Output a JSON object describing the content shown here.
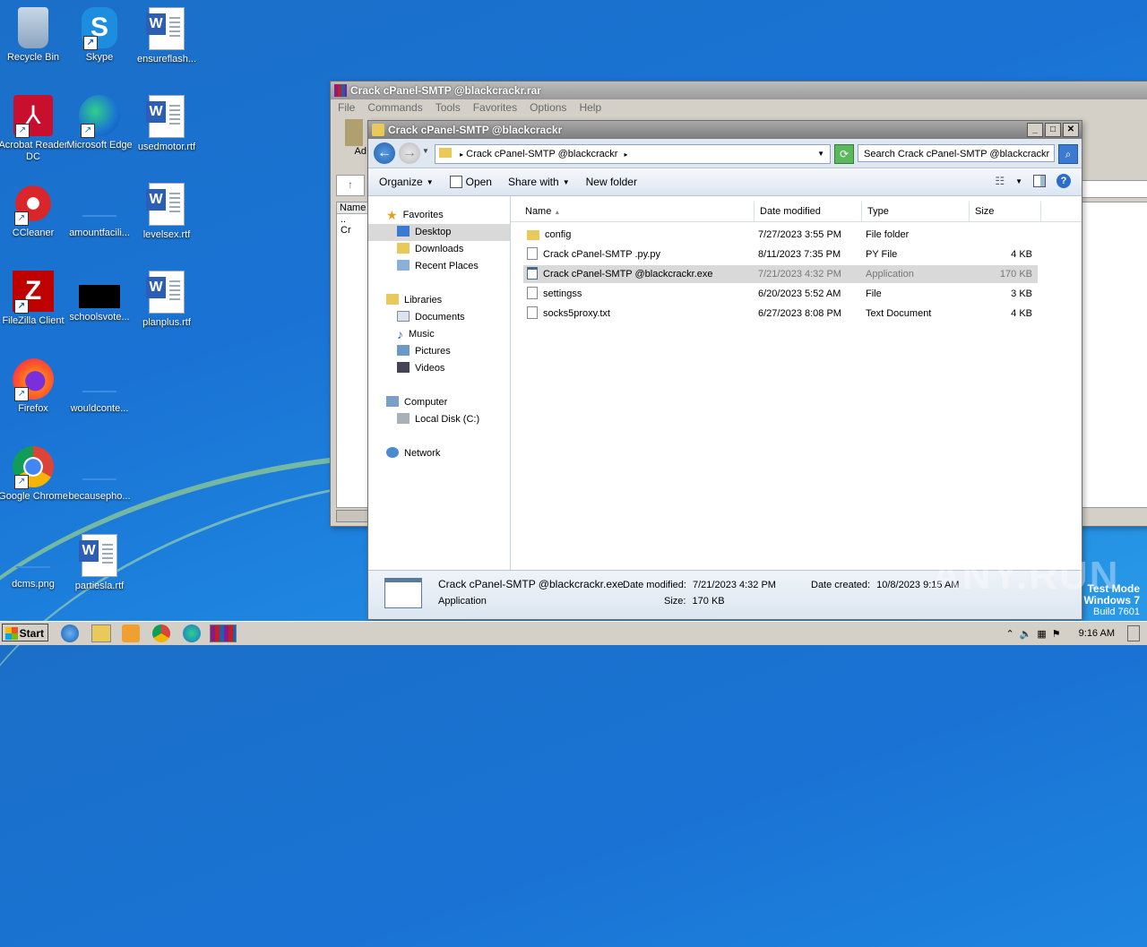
{
  "desktop": {
    "icons": [
      {
        "label": "Recycle Bin"
      },
      {
        "label": "Skype"
      },
      {
        "label": "ensureflash..."
      },
      {
        "label": "Acrobat Reader DC"
      },
      {
        "label": "Microsoft Edge"
      },
      {
        "label": "usedmotor.rtf"
      },
      {
        "label": "CCleaner"
      },
      {
        "label": "amountfacili..."
      },
      {
        "label": "levelsex.rtf"
      },
      {
        "label": "FileZilla Client"
      },
      {
        "label": "schoolsvote..."
      },
      {
        "label": "planplus.rtf"
      },
      {
        "label": "Firefox"
      },
      {
        "label": "wouldconte..."
      },
      {
        "label": "Google Chrome"
      },
      {
        "label": "becausepho..."
      },
      {
        "label": "dcms.png"
      },
      {
        "label": "partiesla.rtf"
      }
    ]
  },
  "rar_window": {
    "title": "Crack cPanel-SMTP @blackcrackr.rar",
    "menu": [
      "File",
      "Commands",
      "Tools",
      "Favorites",
      "Options",
      "Help"
    ],
    "add_label": "Ad",
    "col_name": "Name",
    "row1": "..",
    "row2": "Cr"
  },
  "explorer": {
    "title": "Crack cPanel-SMTP @blackcrackr",
    "address": "Crack cPanel-SMTP @blackcrackr",
    "search_placeholder": "Search Crack cPanel-SMTP @blackcrackr",
    "toolbar": {
      "organize": "Organize",
      "open": "Open",
      "share_with": "Share with",
      "new_folder": "New folder"
    },
    "nav": {
      "favorites": "Favorites",
      "desktop": "Desktop",
      "downloads": "Downloads",
      "recent_places": "Recent Places",
      "libraries": "Libraries",
      "documents": "Documents",
      "music": "Music",
      "pictures": "Pictures",
      "videos": "Videos",
      "computer": "Computer",
      "local_disk": "Local Disk (C:)",
      "network": "Network"
    },
    "columns": {
      "name": "Name",
      "date": "Date modified",
      "type": "Type",
      "size": "Size"
    },
    "files": [
      {
        "name": "config",
        "date": "7/27/2023 3:55 PM",
        "type": "File folder",
        "size": ""
      },
      {
        "name": "Crack cPanel-SMTP .py.py",
        "date": "8/11/2023 7:35 PM",
        "type": "PY File",
        "size": "4 KB"
      },
      {
        "name": "Crack cPanel-SMTP @blackcrackr.exe",
        "date": "7/21/2023 4:32 PM",
        "type": "Application",
        "size": "170 KB"
      },
      {
        "name": "settingss",
        "date": "6/20/2023 5:52 AM",
        "type": "File",
        "size": "3 KB"
      },
      {
        "name": "socks5proxy.txt",
        "date": "6/27/2023 8:08 PM",
        "type": "Text Document",
        "size": "4 KB"
      }
    ],
    "details": {
      "name": "Crack cPanel-SMTP @blackcrackr.exe",
      "kind": "Application",
      "modified_label": "Date modified:",
      "modified_value": "7/21/2023 4:32 PM",
      "size_label": "Size:",
      "size_value": "170 KB",
      "created_label": "Date created:",
      "created_value": "10/8/2023 9:15 AM"
    }
  },
  "taskbar": {
    "start": "Start",
    "clock": "9:16 AM"
  },
  "watermark": {
    "line1": "Test Mode",
    "line2": "Windows 7",
    "line3": "Build 7601",
    "brand": "ANY.RUN"
  }
}
